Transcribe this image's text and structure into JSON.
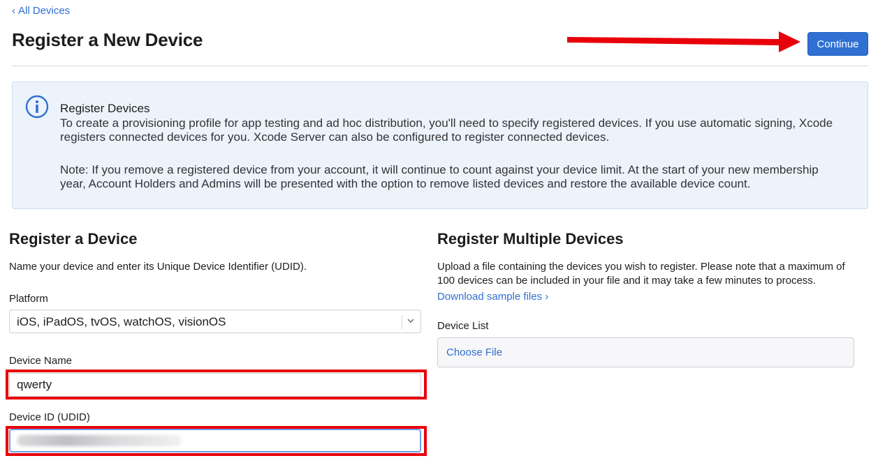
{
  "nav": {
    "back_label": "All Devices"
  },
  "header": {
    "title": "Register a New Device",
    "continue_label": "Continue"
  },
  "info": {
    "heading": "Register Devices",
    "paragraph1": "To create a provisioning profile for app testing and ad hoc distribution, you'll need to specify registered devices. If you use automatic signing, Xcode registers connected devices for you. Xcode Server can also be configured to register connected devices.",
    "paragraph2": "Note: If you remove a registered device from your account, it will continue to count against your device limit. At the start of your new membership year, Account Holders and Admins will be presented with the option to remove listed devices and restore the available device count."
  },
  "single": {
    "title": "Register a Device",
    "description": "Name your device and enter its Unique Device Identifier (UDID).",
    "platform_label": "Platform",
    "platform_value": "iOS, iPadOS, tvOS, watchOS, visionOS",
    "name_label": "Device Name",
    "name_value": "qwerty",
    "udid_label": "Device ID (UDID)"
  },
  "multiple": {
    "title": "Register Multiple Devices",
    "description": "Upload a file containing the devices you wish to register. Please note that a maximum of 100 devices can be included in your file and it may take a few minutes to process.",
    "download_link": "Download sample files ›",
    "list_label": "Device List",
    "choose_file": "Choose File"
  },
  "colors": {
    "accent": "#2f70d2",
    "annotation": "#e8000b",
    "info_bg": "#edf3fb"
  },
  "icons": {
    "info": "info-circle-icon",
    "back": "chevron-left-icon",
    "select": "chevron-down-icon"
  }
}
